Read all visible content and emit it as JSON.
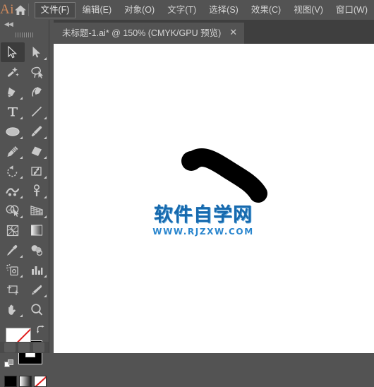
{
  "app": {
    "logo_text": "Ai",
    "home_icon": "home-icon"
  },
  "menubar": {
    "items": [
      {
        "label": "文件(F)",
        "active": true
      },
      {
        "label": "编辑(E)",
        "active": false
      },
      {
        "label": "对象(O)",
        "active": false
      },
      {
        "label": "文字(T)",
        "active": false
      },
      {
        "label": "选择(S)",
        "active": false
      },
      {
        "label": "效果(C)",
        "active": false
      },
      {
        "label": "视图(V)",
        "active": false
      },
      {
        "label": "窗口(W)",
        "active": false
      }
    ]
  },
  "tabbar": {
    "tab_title": "未标题-1.ai* @ 150% (CMYK/GPU 预览)",
    "close_label": "✕"
  },
  "toolbar": {
    "collapse_label": "◀◀",
    "tools": [
      {
        "name": "selection-tool",
        "icon": "arrow-solid",
        "active": true,
        "corner": false
      },
      {
        "name": "direct-selection-tool",
        "icon": "arrow-hollow",
        "active": false,
        "corner": true
      },
      {
        "name": "magic-wand-tool",
        "icon": "magic-wand",
        "active": false,
        "corner": false
      },
      {
        "name": "lasso-tool",
        "icon": "lasso",
        "active": false,
        "corner": false
      },
      {
        "name": "pen-tool",
        "icon": "pen",
        "active": false,
        "corner": true
      },
      {
        "name": "curvature-tool",
        "icon": "curvature",
        "active": false,
        "corner": false
      },
      {
        "name": "type-tool",
        "icon": "type-T",
        "active": false,
        "corner": true
      },
      {
        "name": "line-segment-tool",
        "icon": "line-segment",
        "active": false,
        "corner": true
      },
      {
        "name": "ellipse-tool",
        "icon": "ellipse",
        "active": false,
        "corner": true
      },
      {
        "name": "paintbrush-tool",
        "icon": "paintbrush",
        "active": false,
        "corner": true
      },
      {
        "name": "pencil-tool",
        "icon": "pencil",
        "active": false,
        "corner": true
      },
      {
        "name": "eraser-tool",
        "icon": "eraser",
        "active": false,
        "corner": true
      },
      {
        "name": "rotate-tool",
        "icon": "rotate",
        "active": false,
        "corner": true
      },
      {
        "name": "scale-tool",
        "icon": "scale",
        "active": false,
        "corner": true
      },
      {
        "name": "width-tool",
        "icon": "width-warp",
        "active": false,
        "corner": true
      },
      {
        "name": "free-transform-tool",
        "icon": "puppet-pin",
        "active": false,
        "corner": true
      },
      {
        "name": "shape-builder-tool",
        "icon": "shape-builder",
        "active": false,
        "corner": true
      },
      {
        "name": "perspective-grid-tool",
        "icon": "perspective-grid",
        "active": false,
        "corner": true
      },
      {
        "name": "mesh-tool",
        "icon": "mesh",
        "active": false,
        "corner": false
      },
      {
        "name": "gradient-tool",
        "icon": "gradient",
        "active": false,
        "corner": false
      },
      {
        "name": "eyedropper-tool",
        "icon": "eyedropper",
        "active": false,
        "corner": true
      },
      {
        "name": "blend-tool",
        "icon": "blend",
        "active": false,
        "corner": false
      },
      {
        "name": "symbol-sprayer-tool",
        "icon": "symbol-sprayer",
        "active": false,
        "corner": true
      },
      {
        "name": "column-graph-tool",
        "icon": "column-graph",
        "active": false,
        "corner": true
      },
      {
        "name": "artboard-tool",
        "icon": "artboard",
        "active": false,
        "corner": false
      },
      {
        "name": "slice-tool",
        "icon": "slice-knife",
        "active": false,
        "corner": true
      },
      {
        "name": "hand-tool",
        "icon": "hand",
        "active": false,
        "corner": true
      },
      {
        "name": "zoom-tool",
        "icon": "magnifier",
        "active": false,
        "corner": false
      }
    ],
    "fill_stroke": {
      "fill_name": "fill-swatch-none",
      "stroke_name": "stroke-swatch-black",
      "fill_color": "#ffffff",
      "fill_is_none": true,
      "stroke_color": "#000000",
      "swap_icon": "swap-arrow-icon",
      "default_icon": "default-fill-stroke-icon",
      "modes": [
        {
          "name": "color-mode-button",
          "label": "color"
        },
        {
          "name": "gradient-mode-button",
          "label": "gradient"
        },
        {
          "name": "none-mode-button",
          "label": "none"
        }
      ]
    },
    "screen_modes": [
      {
        "name": "screen-mode-normal"
      },
      {
        "name": "screen-mode-fullscreen-menu"
      },
      {
        "name": "screen-mode-fullscreen"
      }
    ]
  },
  "canvas": {
    "artwork_name": "black-brush-stroke-path",
    "artwork_color": "#000000",
    "background_color": "#ffffff",
    "watermark": {
      "main": "软件自学网",
      "sub": "WWW.RJZXW.COM",
      "main_color": "#1769ad",
      "sub_color": "#2a86ce"
    }
  }
}
